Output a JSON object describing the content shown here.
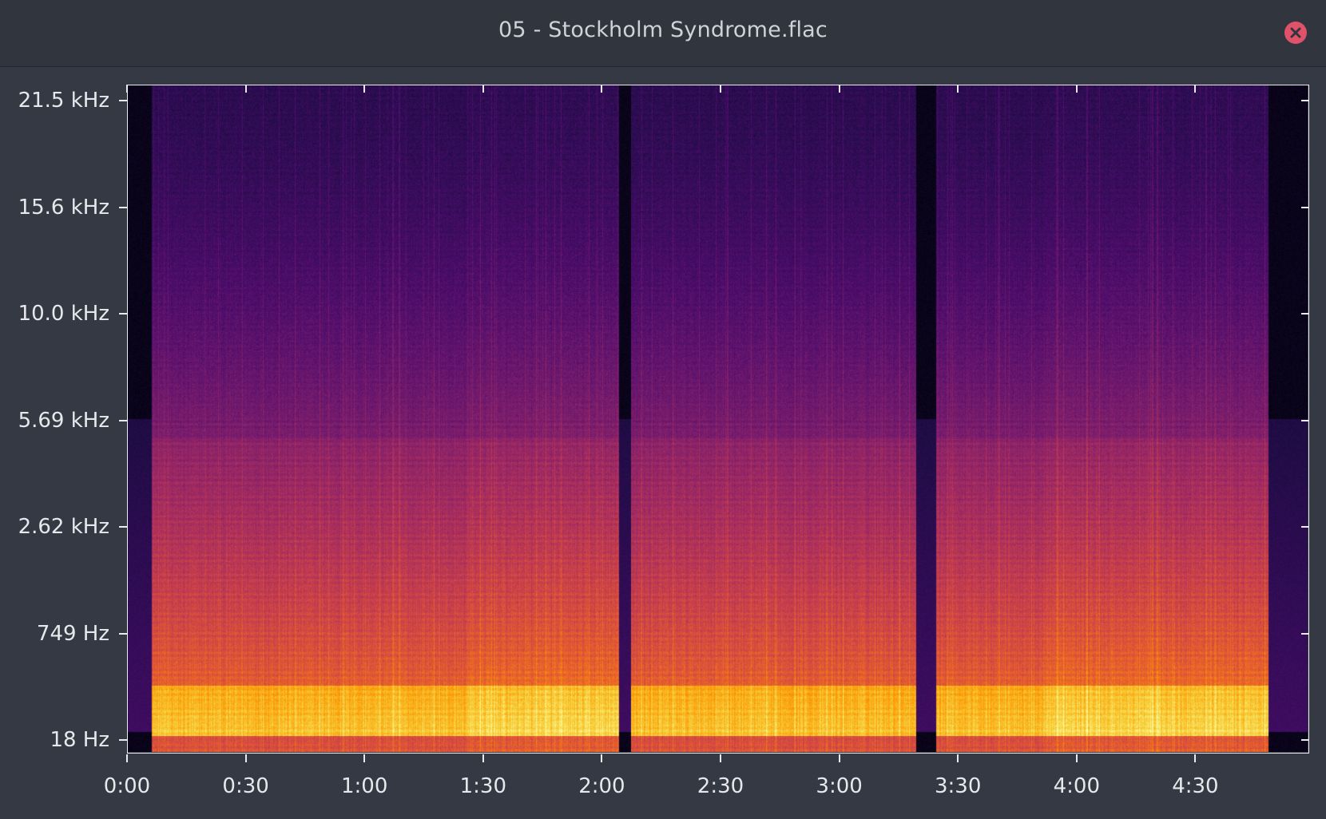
{
  "window": {
    "title": "05 - Stockholm Syndrome.flac",
    "close_icon": "close-icon"
  },
  "colors": {
    "window_bg": "#343943",
    "titlebar_bg": "#30353e",
    "close_button": "#e0516a",
    "colormap": [
      "#000004",
      "#1b0c41",
      "#4a0c6b",
      "#781c6d",
      "#a52c60",
      "#cf4446",
      "#ed6925",
      "#fb9b06",
      "#f7d13d",
      "#fcffa4"
    ]
  },
  "chart_data": {
    "type": "heatmap",
    "title": "05 - Stockholm Syndrome.flac",
    "xlabel": "",
    "ylabel": "",
    "x_scale": "time",
    "y_scale": "log-like frequency",
    "x_ticks": [
      "0:00",
      "0:30",
      "1:00",
      "1:30",
      "2:00",
      "2:30",
      "3:00",
      "3:30",
      "4:00",
      "4:30"
    ],
    "y_ticks": [
      "21.5 kHz",
      "15.6 kHz",
      "10.0 kHz",
      "5.69 kHz",
      "2.62 kHz",
      "749 Hz",
      "18 Hz"
    ],
    "xlim_seconds": [
      0,
      298
    ],
    "ylim": [
      "18 Hz",
      "21.5 kHz"
    ],
    "silent_gaps_seconds": [
      [
        0,
        6
      ],
      [
        124,
        127
      ],
      [
        199,
        204
      ],
      [
        288,
        298
      ]
    ],
    "grid": false,
    "legend": "none"
  }
}
